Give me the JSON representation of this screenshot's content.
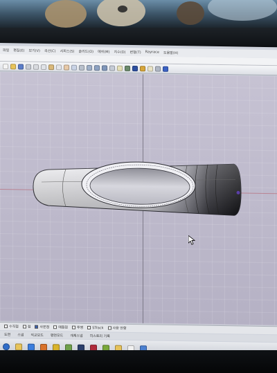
{
  "menu": {
    "items": [
      "파일",
      "편집(E)",
      "보기(V)",
      "곡선(C)",
      "서피스(S)",
      "솔리드(O)",
      "메쉬(M)",
      "치수(D)",
      "변형(T)",
      "Rayrace",
      "도움말(H)"
    ]
  },
  "status_bar": {
    "checks": [
      {
        "label": "수직점",
        "checked": false
      },
      {
        "label": "점",
        "checked": false
      },
      {
        "label": "사분점",
        "checked": true
      },
      {
        "label": "매듭점",
        "checked": false
      },
      {
        "label": "투영",
        "checked": false
      },
      {
        "label": "STrack",
        "checked": false
      },
      {
        "label": "사용 안함",
        "checked": false
      }
    ]
  },
  "bottom_tabs": [
    "도면",
    "스냅",
    "직교모드",
    "평면모드",
    "개체스냅",
    "히스토리 기록"
  ],
  "colors": {
    "viewport_bg": "#bdb9cb",
    "x_axis": "#b7707f",
    "y_axis": "#6e6a78",
    "model_light": "#eeeef3",
    "model_dark": "#1a1a1e"
  },
  "viewport": {
    "object": "tube-with-oval-cutout"
  }
}
